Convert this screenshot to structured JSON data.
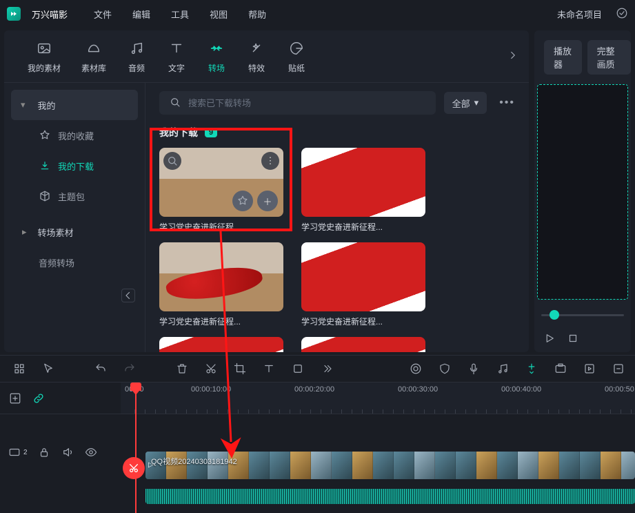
{
  "app": {
    "name": "万兴喵影"
  },
  "menu": {
    "file": "文件",
    "edit": "编辑",
    "tools": "工具",
    "view": "视图",
    "help": "帮助"
  },
  "project": {
    "name": "未命名项目"
  },
  "category_tabs": {
    "my_media": "我的素材",
    "stock": "素材库",
    "audio": "音频",
    "text": "文字",
    "transition": "转场",
    "effects": "特效",
    "stickers": "贴纸"
  },
  "sidebar": {
    "mine_header": "我的",
    "favorites": "我的收藏",
    "downloads": "我的下载",
    "theme": "主题包",
    "transition_assets": "转场素材",
    "audio_transition": "音频转场"
  },
  "search": {
    "placeholder": "搜索已下载转场",
    "filter_all": "全部"
  },
  "gallery": {
    "title": "我的下载",
    "count": "9",
    "item_caption": "学习党史奋进新征程..."
  },
  "preview": {
    "player_tab": "播放器",
    "quality_tab": "完整画质"
  },
  "timeline": {
    "ticks": [
      "00:00",
      "00:00:10:00",
      "00:00:20:00",
      "00:00:30:00",
      "00:00:40:00",
      "00:00:50"
    ],
    "clip_title": "QQ视频20240303181942",
    "track_badge": "2"
  }
}
